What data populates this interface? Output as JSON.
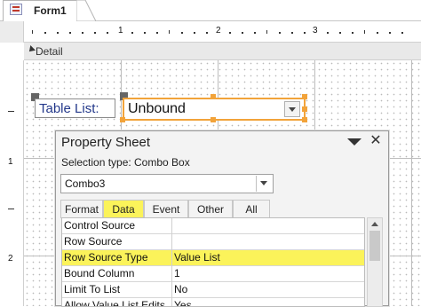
{
  "tab": {
    "label": "Form1"
  },
  "ruler": {
    "top_numbers": [
      "1",
      "2",
      "3"
    ],
    "left_numbers": [
      "1",
      "2"
    ]
  },
  "section": {
    "label": "Detail"
  },
  "form": {
    "label_text": "Table List:",
    "combo_value": "Unbound"
  },
  "property_sheet": {
    "title": "Property Sheet",
    "selection_label": "Selection type:",
    "selection_value": "Combo Box",
    "object_value": "Combo3",
    "tabs": [
      "Format",
      "Data",
      "Event",
      "Other",
      "All"
    ],
    "selected_tab": "Data",
    "rows": [
      {
        "name": "Control Source",
        "value": ""
      },
      {
        "name": "Row Source",
        "value": ""
      },
      {
        "name": "Row Source Type",
        "value": "Value List"
      },
      {
        "name": "Bound Column",
        "value": "1"
      },
      {
        "name": "Limit To List",
        "value": "No"
      },
      {
        "name": "Allow Value List Edits",
        "value": "Yes"
      }
    ]
  },
  "colors": {
    "highlight": "#fbf35a",
    "selection_orange": "#f2a33a",
    "label_text": "#23388a"
  }
}
